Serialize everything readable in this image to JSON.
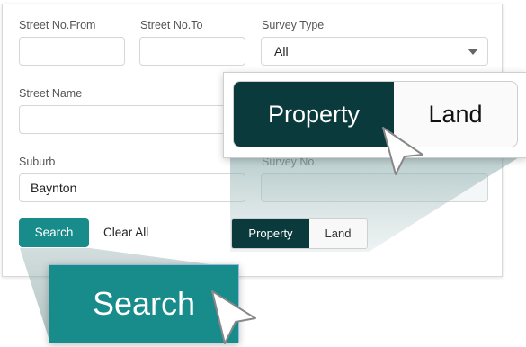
{
  "form": {
    "street_no_from_label": "Street No.From",
    "street_no_to_label": "Street No.To",
    "survey_type_label": "Survey Type",
    "survey_type_value": "All",
    "street_name_label": "Street Name",
    "suburb_label": "Suburb",
    "suburb_value": "Baynton",
    "survey_no_label": "Survey No."
  },
  "actions": {
    "search_label": "Search",
    "clear_label": "Clear All"
  },
  "toggle": {
    "property_label": "Property",
    "land_label": "Land",
    "selected": "Property"
  },
  "zoom": {
    "property_label": "Property",
    "land_label": "Land",
    "search_label": "Search"
  },
  "colors": {
    "teal": "#188b8b",
    "dark_teal": "#0b3a3d"
  }
}
